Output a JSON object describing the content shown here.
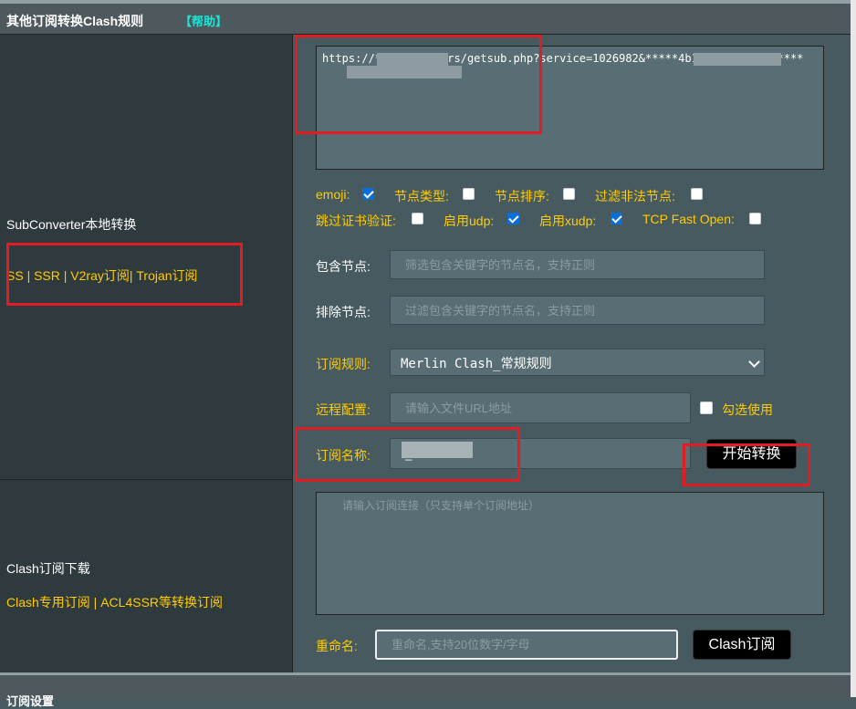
{
  "header": {
    "title": "其他订阅转换Clash规则",
    "help": "【帮助】"
  },
  "left1": {
    "title": "SubConverter本地转换",
    "subtitle": "SS | SSR | V2ray订阅| Trojan订阅"
  },
  "left2": {
    "title": "Clash订阅下载",
    "subtitle": "Clash专用订阅 | ACL4SSR等转换订阅"
  },
  "sub_url": {
    "value": "https://*****/members/getsub.php?service=1026982&*****4b13-4db8-8372*****"
  },
  "options": [
    {
      "label": "emoji:",
      "checked": true
    },
    {
      "label": "节点类型:",
      "checked": false
    },
    {
      "label": "节点排序:",
      "checked": false
    },
    {
      "label": "过滤非法节点:",
      "checked": false
    },
    {
      "label": "跳过证书验证:",
      "checked": false
    },
    {
      "label": "启用udp:",
      "checked": true
    },
    {
      "label": "启用xudp:",
      "checked": true
    },
    {
      "label": "TCP Fast Open:",
      "checked": false
    }
  ],
  "include": {
    "label": "包含节点:",
    "placeholder": "筛选包含关键字的节点名，支持正则"
  },
  "exclude": {
    "label": "排除节点:",
    "placeholder": "过滤包含关键字的节点名，支持正则"
  },
  "rules": {
    "label": "订阅规则:",
    "value": "Merlin Clash_常规规则"
  },
  "remote": {
    "label": "远程配置:",
    "placeholder": "请输入文件URL地址",
    "check_label": "勾选使用"
  },
  "subname": {
    "label": "订阅名称:",
    "value": "_"
  },
  "convert_button": "开始转换",
  "clash_url": {
    "placeholder": "请输入订阅连接（只支持单个订阅地址）"
  },
  "rename": {
    "label": "重命名:",
    "placeholder": "重命名,支持20位数字/字母"
  },
  "clash_button": "Clash订阅",
  "footer": {
    "title": "订阅设置"
  },
  "colors": {
    "accent_yellow": "#ffcc00",
    "help_cyan": "#1ce5d8",
    "highlight_red": "#e31b23"
  }
}
